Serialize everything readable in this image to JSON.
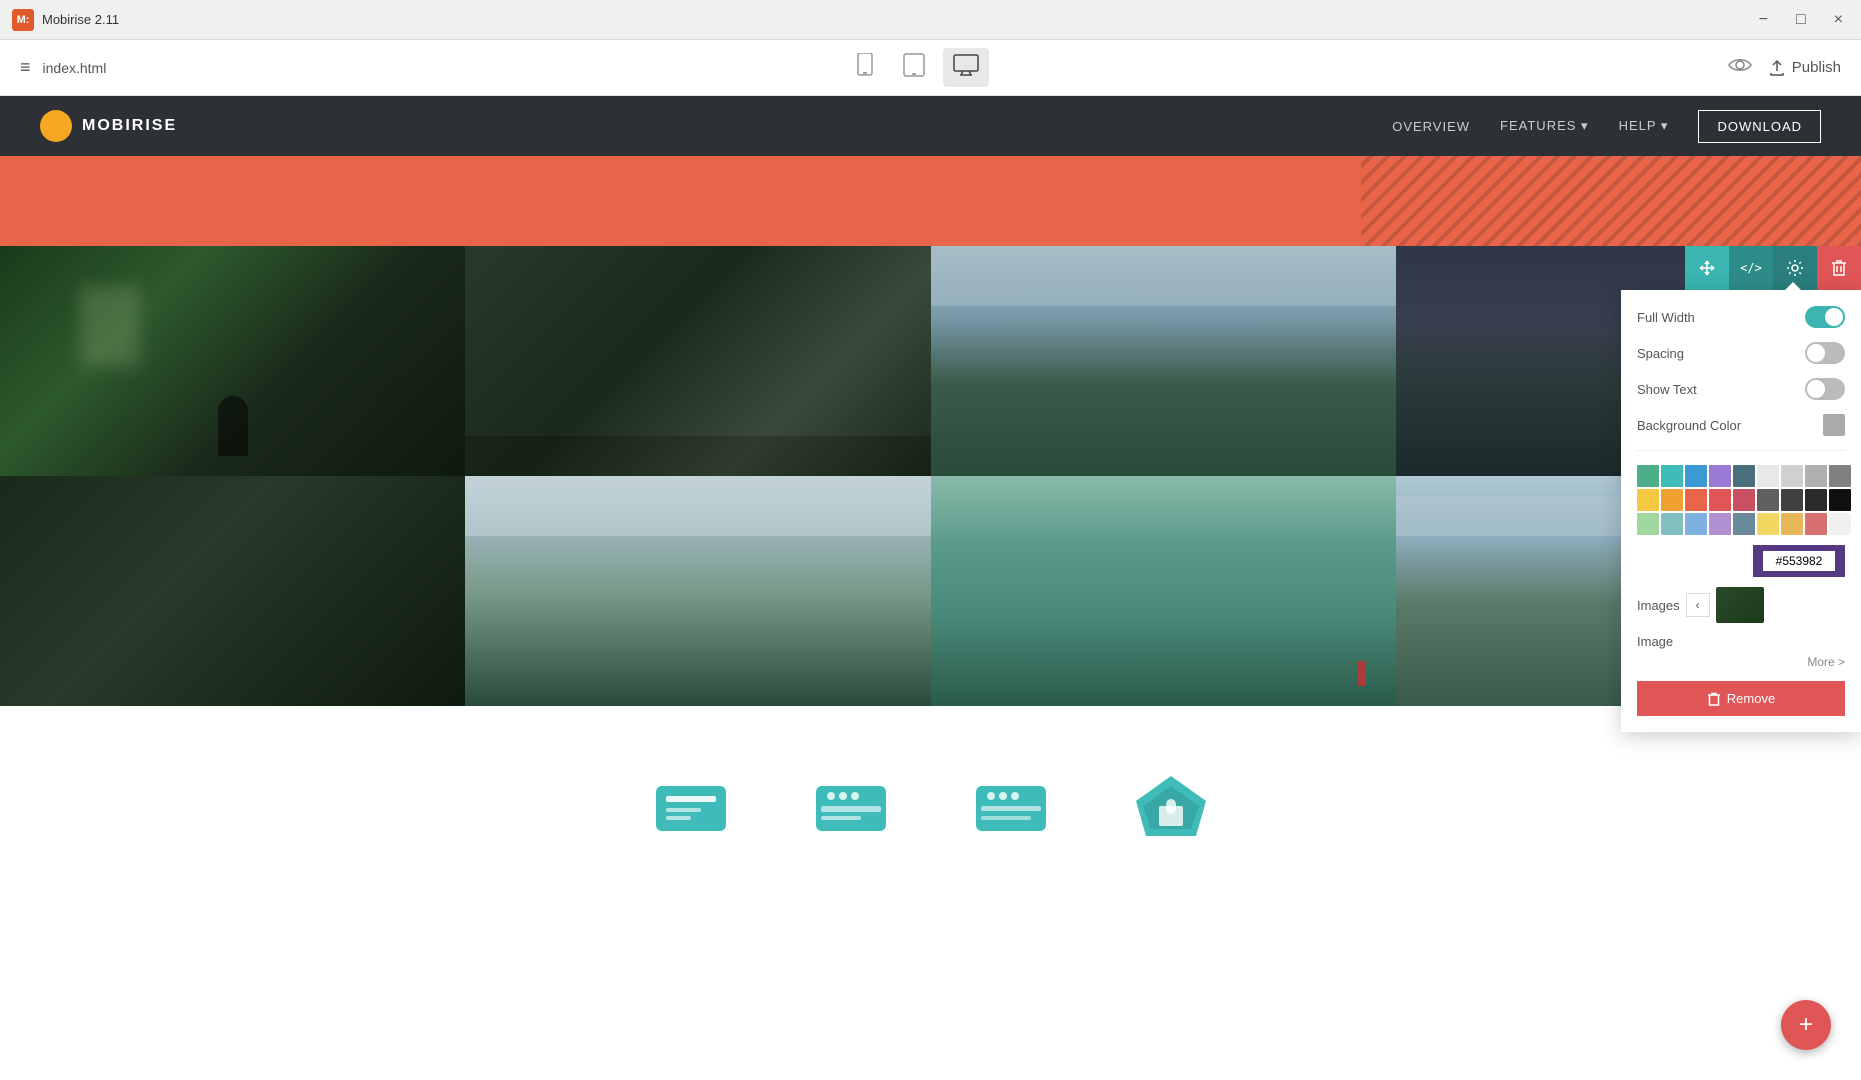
{
  "app": {
    "name": "Mobirise 2.11",
    "logo_text": "M:",
    "file": "index.html"
  },
  "titlebar": {
    "minimize_label": "−",
    "maximize_label": "□",
    "close_label": "×"
  },
  "toolbar": {
    "hamburger_label": "≡",
    "file_name": "index.html",
    "publish_label": "Publish",
    "devices": [
      {
        "id": "mobile",
        "label": "📱"
      },
      {
        "id": "tablet",
        "label": "⬜"
      },
      {
        "id": "desktop",
        "label": "🖥",
        "active": true
      }
    ]
  },
  "site_nav": {
    "logo_text": "MOBIRISE",
    "links": [
      "OVERVIEW",
      "FEATURES ▾",
      "HELP ▾"
    ],
    "cta": "DOWNLOAD"
  },
  "gallery_toolbar": {
    "move_icon": "⇅",
    "code_icon": "</>",
    "settings_icon": "⚙",
    "delete_icon": "🗑"
  },
  "settings_panel": {
    "full_width_label": "Full Width",
    "full_width_on": true,
    "spacing_label": "Spacing",
    "spacing_on": false,
    "show_text_label": "Show Text",
    "show_text_on": false,
    "background_color_label": "Background Color",
    "images_label": "Images",
    "image_label": "Image",
    "more_label": "More >",
    "remove_label": "Remove",
    "color_hex": "#553982",
    "colors": [
      "#4caf8a",
      "#3fbcba",
      "#3b99d4",
      "#9b7cd4",
      "#4a6f7c",
      "#f5c842",
      "#f0a030",
      "#e05555",
      "#c0c0c0",
      "#e8e8e8",
      "#d0d0d0",
      "#b0b0b0",
      "#808080",
      "#606060",
      "#a0d8a0",
      "#80c0c0",
      "#80b0e0",
      "#b090d0",
      "#6a8a9a",
      "#f0d860",
      "#e8b858",
      "#d87070",
      "#f0f0f0",
      "#ffffff",
      "#f5f5f5",
      "#eeeeee",
      "#cccccc",
      "#999999",
      "#1a1a1a",
      "#2a2a2a",
      "#404040",
      "#555555",
      "#777777",
      "#f5a623",
      "#e87030",
      "#c03030",
      "#303030",
      "#101010"
    ]
  },
  "fab": {
    "label": "+"
  }
}
